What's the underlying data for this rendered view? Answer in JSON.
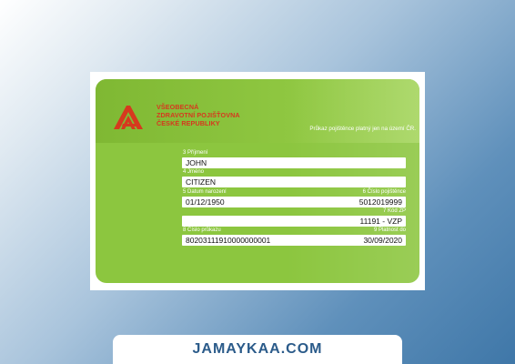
{
  "card": {
    "insurer_line1": "VŠEOBECNÁ",
    "insurer_line2": "ZDRAVOTNÍ POJIŠŤOVNA",
    "insurer_line3": "ČESKÉ REPUBLIKY",
    "notice": "Průkaz pojištěnce platný jen na území ČR.",
    "surname_label": "3 Příjmení",
    "surname": "JOHN",
    "name_label": "4 Jméno",
    "name": "CITIZEN",
    "birth_label": "5 Datum narození",
    "birth": "01/12/1950",
    "insured_no_label": "6 Číslo pojištěnce",
    "insured_no": "5012019999",
    "insurer_code_label": "7 Kód ZP",
    "insurer_code": "11191 - VZP",
    "card_no_label": "8 Číslo průkazu",
    "card_no": "80203111910000000001",
    "validity_label": "9 Platnost do",
    "validity": "30/09/2020"
  },
  "banner": {
    "text": "JAMAYKAA.COM"
  },
  "colors": {
    "card_green": "#8cc63f",
    "logo_red": "#d6391e",
    "banner_text": "#2b5b8a"
  },
  "icons": {
    "logo": "vzp-logo-icon"
  }
}
